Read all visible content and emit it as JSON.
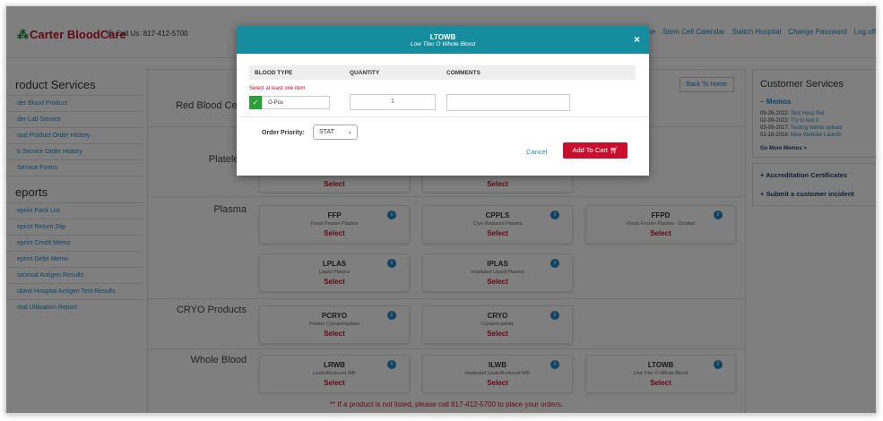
{
  "header": {
    "logo_text": "Carter BloodCare",
    "phone": "Call Us: 817-412-5700",
    "nav": [
      "Home",
      "Stem Cell Calendar",
      "Switch Hospital",
      "Change Password",
      "Log off"
    ]
  },
  "sidebar": {
    "product_services_title": "roduct Services",
    "product_services": [
      "der Blood Product",
      "der Lab Service",
      "ood Product Order History",
      "b Service Order History",
      "Service Forms"
    ],
    "reports_title": "eports",
    "reports": [
      "eprint Pack List",
      "eprint Return Slip",
      "eprint Credit Memo",
      "eprint Debit Memo",
      "istorical Antigen Results",
      "ubmit Hospital Antigen Test Results",
      "ood Utilization Report"
    ]
  },
  "main": {
    "back_label": "Back To Home",
    "sections": [
      {
        "title": "Red Blood Cells",
        "cards": []
      },
      {
        "title": "Platelets",
        "cards": [
          {
            "code": "",
            "desc": "",
            "select": "Select"
          },
          {
            "code": "",
            "desc": "",
            "select": "Select"
          }
        ]
      },
      {
        "title": "Plasma",
        "cards": [
          {
            "code": "FFP",
            "desc": "Fresh Frozen Plasma",
            "select": "Select"
          },
          {
            "code": "CPPLS",
            "desc": "Cryo Reduced Plasma",
            "select": "Select"
          },
          {
            "code": "FFPD",
            "desc": "Fresh Frozen Plasma - Divided",
            "select": "Select"
          },
          {
            "code": "LPLAS",
            "desc": "Liquid Plasma",
            "select": "Select"
          },
          {
            "code": "IPLAS",
            "desc": "Irradiated Liquid Plasma",
            "select": "Select"
          }
        ]
      },
      {
        "title": "CRYO Products",
        "cards": [
          {
            "code": "PCRYO",
            "desc": "Pooled Cryoprecipitate",
            "select": "Select"
          },
          {
            "code": "CRYO",
            "desc": "Cryoprecipitate",
            "select": "Select"
          }
        ]
      },
      {
        "title": "Whole Blood",
        "cards": [
          {
            "code": "LRWB",
            "desc": "LeukoReduced WB",
            "select": "Select"
          },
          {
            "code": "ILWB",
            "desc": "Irradiated LeukoReduced WB",
            "select": "Select"
          },
          {
            "code": "LTOWB",
            "desc": "Low Titer O Whole Blood",
            "select": "Select"
          }
        ]
      }
    ],
    "footnote": "** If a product is not listed, please call 817-412-5700 to place your orders."
  },
  "right": {
    "title": "Customer Services",
    "memos_label": "Memos",
    "memos": [
      {
        "date": "09-26-2022:",
        "text": "Test Hosp Rel"
      },
      {
        "date": "02-09-2022:",
        "text": "Try to test it"
      },
      {
        "date": "03-09-2017:",
        "text": "Testing memo upload"
      },
      {
        "date": "01-18-2016:",
        "text": "New Website Launch"
      }
    ],
    "more_memos": "Go More Memos >",
    "accreditation": "Accreditation Certificates",
    "incident": "Submit a customer incident"
  },
  "modal": {
    "title": "LTOWB",
    "subtitle": "Low Titer O Whole Blood",
    "close": "×",
    "col_blood_type": "BLOOD TYPE",
    "col_quantity": "QUANTITY",
    "col_comments": "COMMENTS",
    "error": "Select at least one item",
    "blood_type_value": "O-Pos",
    "quantity_value": "1",
    "comments_value": "",
    "order_priority_label": "Order Priority:",
    "order_priority_value": "STAT",
    "cancel_label": "Cancel",
    "add_to_cart_label": "Add To Cart"
  },
  "colors": {
    "teal": "#168d9e",
    "red": "#c8102e",
    "blue": "#1e88c8",
    "green": "#2e9e3a"
  }
}
